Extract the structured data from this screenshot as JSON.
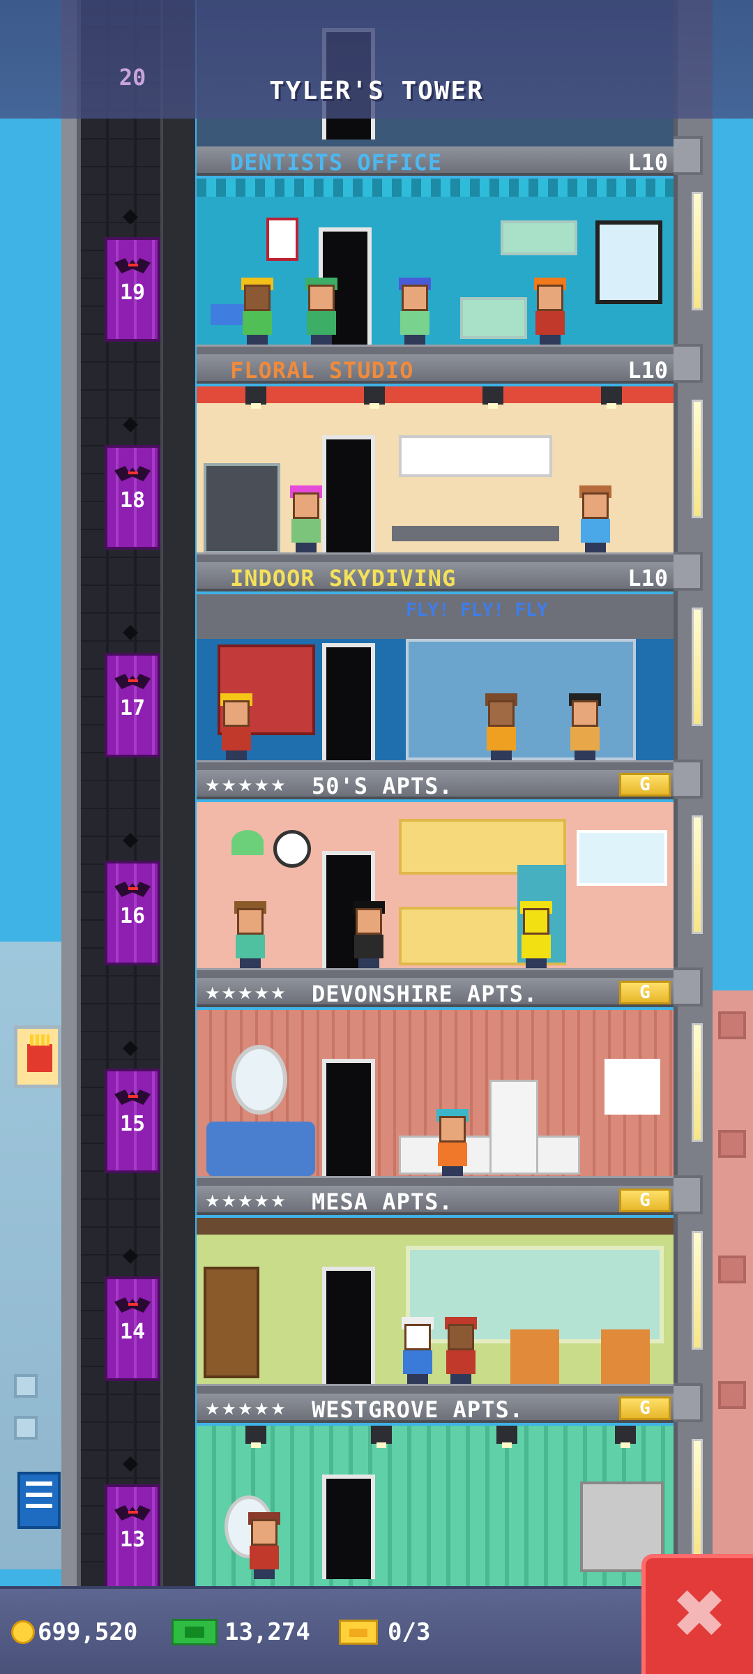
{
  "tower": {
    "title": "TYLER'S TOWER",
    "top_floor_number": "20"
  },
  "floors": [
    {
      "number": "19",
      "name": "DENTISTS OFFICE",
      "level": "L10",
      "kind": "business",
      "name_color": "#4db8f0"
    },
    {
      "number": "18",
      "name": "FLORAL STUDIO",
      "level": "L10",
      "kind": "business",
      "name_color": "#f08a3c"
    },
    {
      "number": "17",
      "name": "INDOOR SKYDIVING",
      "level": "L10",
      "kind": "business",
      "name_color": "#f4e15a",
      "wall_text": "FLY! FLY! FLY"
    },
    {
      "number": "16",
      "name": "50'S APTS.",
      "kind": "residential",
      "stars": "★★★★★",
      "badge": "G"
    },
    {
      "number": "15",
      "name": "DEVONSHIRE APTS.",
      "kind": "residential",
      "stars": "★★★★★",
      "badge": "G"
    },
    {
      "number": "14",
      "name": "MESA APTS.",
      "kind": "residential",
      "stars": "★★★★★",
      "badge": "G"
    },
    {
      "number": "13",
      "name": "WESTGROVE APTS.",
      "kind": "residential",
      "stars": "★★★★★",
      "badge": "G"
    }
  ],
  "hud": {
    "coins": "699,520",
    "bux": "13,274",
    "tickets": "0/3"
  },
  "icons": {
    "coin": "coin-icon",
    "bux": "bux-icon",
    "ticket": "ticket-icon",
    "close": "close-icon"
  },
  "close_button": {
    "label": "✖"
  },
  "colors": {
    "elevator": "#8e1fb0",
    "close_button": "#e33a3a",
    "hud_bg": "#4a527a"
  }
}
